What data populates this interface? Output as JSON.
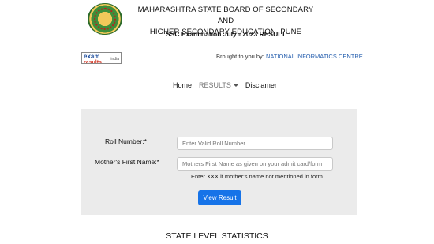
{
  "header": {
    "board_line1": "MAHARASHTRA STATE BOARD OF SECONDARY AND",
    "board_line2": "HIGHER SECONDARY EDUCATION, PUNE",
    "exam_title": "SSC Examination July - 2023 RESULT"
  },
  "partner": {
    "logo_text1": "exam",
    "logo_text2": "results",
    "logo_text3": "india",
    "brought_prefix": "Brought to you by:",
    "brought_link": "NATIONAL INFORMATICS CENTRE"
  },
  "nav": {
    "home": "Home",
    "results": "RESULTS",
    "disclaimer": "Disclamer"
  },
  "form": {
    "roll_label": "Roll Number:*",
    "roll_placeholder": "Enter Valid Roll Number",
    "mother_label": "Mother's First Name:*",
    "mother_placeholder": "Mothers First Name as given on your admit card/form",
    "hint": "Enter XXX if mother's name not mentioned in form",
    "submit": "View Result"
  },
  "stats_heading": "STATE LEVEL STATISTICS",
  "colors": {
    "button": "#1673e8",
    "link": "#2a62b0",
    "panel": "#ebebeb"
  }
}
